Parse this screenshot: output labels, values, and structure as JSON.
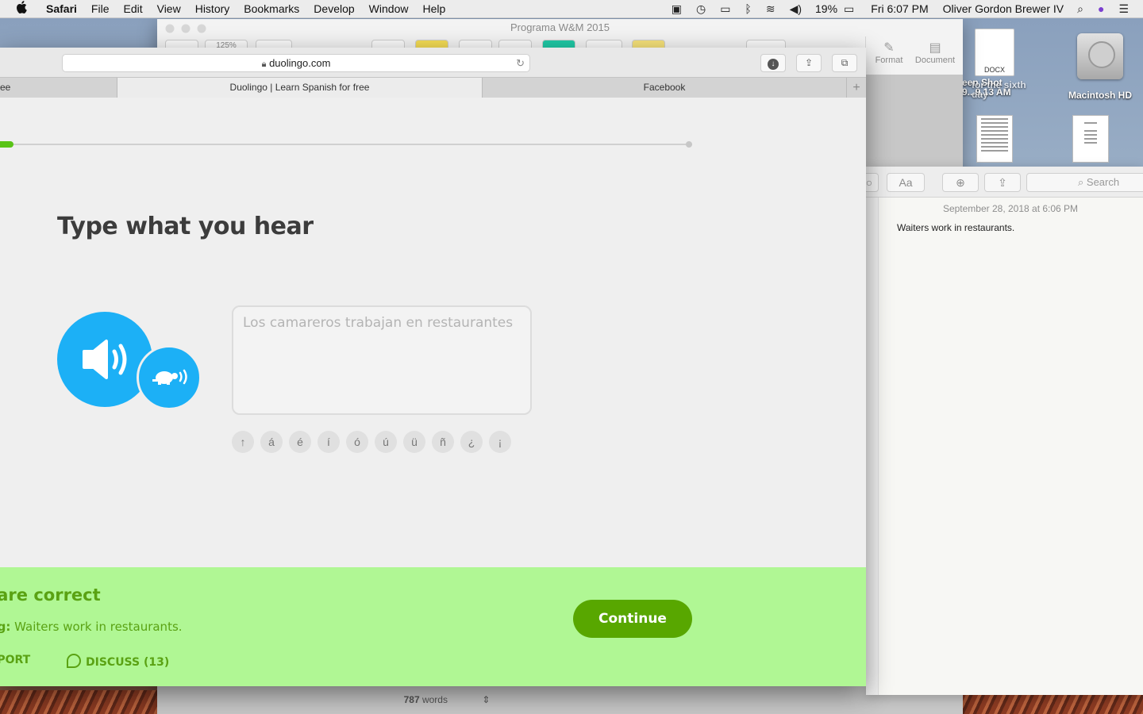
{
  "menubar": {
    "app_name": "Safari",
    "menus": [
      "File",
      "Edit",
      "View",
      "History",
      "Bookmarks",
      "Develop",
      "Window",
      "Help"
    ],
    "battery": "19%",
    "clock": "Fri 6:07 PM",
    "user": "Oliver Gordon Brewer IV"
  },
  "pages": {
    "title": "Programa W&M 2015",
    "zoom": "125%",
    "format_label": "Format",
    "document_label": "Document",
    "word_count": "787",
    "words_label": "words"
  },
  "desktop": {
    "docx_label": "DOCX",
    "screenshot_line1": "een Shot",
    "screenshot_line2": "9...9.13 AM",
    "screenshot_overlay": "for the sixth day",
    "hdd_label": "Macintosh HD"
  },
  "notes": {
    "font_button": "Aa",
    "search_placeholder": "Search",
    "date": "September 28, 2018 at 6:06 PM",
    "text": "Waiters work in restaurants."
  },
  "safari": {
    "url": "duolingo.com",
    "tabs": [
      "ee",
      "Duolingo | Learn Spanish for free",
      "Facebook"
    ],
    "new_tab": "+"
  },
  "duolingo": {
    "progress_fraction": 0.02,
    "heading": "Type what you hear",
    "answer": "Los camareros trabajan en restaurantes",
    "special_chars": [
      "↑",
      "á",
      "é",
      "í",
      "ó",
      "ú",
      "ü",
      "ñ",
      "¿",
      "¡"
    ],
    "result": "u are correct",
    "meaning_label": "aning:",
    "meaning_text": "Waiters work in restaurants.",
    "report": "REPORT",
    "discuss": "DISCUSS (13)",
    "continue": "Continue"
  },
  "colors": {
    "duo_blue": "#1cb0f6",
    "duo_green": "#58a700",
    "feedback_bg": "#b0f794",
    "feedback_text": "#5aa213",
    "progress": "#59c317"
  }
}
